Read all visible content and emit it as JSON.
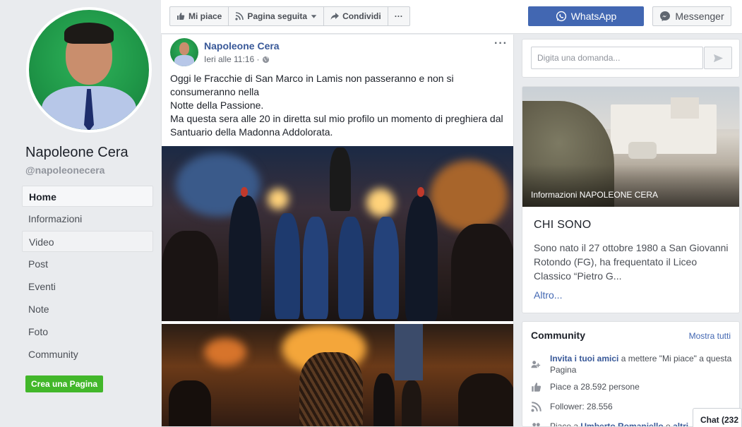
{
  "sidebar": {
    "page_name": "Napoleone Cera",
    "handle": "@napoleonecera",
    "nav": [
      {
        "label": "Home"
      },
      {
        "label": "Informazioni"
      },
      {
        "label": "Video"
      },
      {
        "label": "Post"
      },
      {
        "label": "Eventi"
      },
      {
        "label": "Note"
      },
      {
        "label": "Foto"
      },
      {
        "label": "Community"
      }
    ],
    "create_page": "Crea una Pagina"
  },
  "topbar": {
    "like": "Mi piace",
    "follow": "Pagina seguita",
    "share": "Condividi",
    "more": "···",
    "whatsapp": "WhatsApp",
    "messenger": "Messenger"
  },
  "post": {
    "author": "Napoleone Cera",
    "time": "Ieri alle 11:16 ·",
    "more": "···",
    "lines": [
      "Oggi le Fracchie di San Marco in Lamis non passeranno e non si",
      "consumeranno nella",
      "Notte della Passione.",
      "Ma questa sera alle 20 in diretta sul mio profilo un momento di preghiera dal",
      "Santuario della Madonna Addolorata."
    ]
  },
  "ask": {
    "placeholder": "Digita una domanda..."
  },
  "about": {
    "caption": "Informazioni NAPOLEONE CERA",
    "title": "CHI SONO",
    "text": "Sono nato il 27 ottobre 1980 a San Giovanni Rotondo (FG), ha frequentato il Liceo Classico “Pietro G...",
    "more": "Altro..."
  },
  "community": {
    "title": "Community",
    "show_all": "Mostra tutti",
    "invite_link": "Invita i tuoi amici",
    "invite_rest": " a mettere \"Mi piace\" a questa Pagina",
    "likes": "Piace a 28.592 persone",
    "followers": "Follower: 28.556",
    "liked_by_prefix": "Piace a ",
    "liked_by_name": "Umberto Romaniello",
    "liked_by_suffix": " e ",
    "liked_by_others": "altri"
  },
  "chat": {
    "label": "Chat (232"
  },
  "colors": {
    "brand_blue": "#4267b2",
    "link_blue": "#385898",
    "create_green": "#42b72a",
    "page_bg": "#e9ebee"
  },
  "icons": {
    "like": "thumbs-up-icon",
    "follow": "rss-icon",
    "share": "share-arrow-icon",
    "whatsapp": "whatsapp-icon",
    "messenger": "messenger-icon",
    "globe": "globe-icon",
    "send": "send-icon",
    "invite": "people-icon",
    "likes": "thumbs-up-icon",
    "followers": "rss-icon"
  }
}
